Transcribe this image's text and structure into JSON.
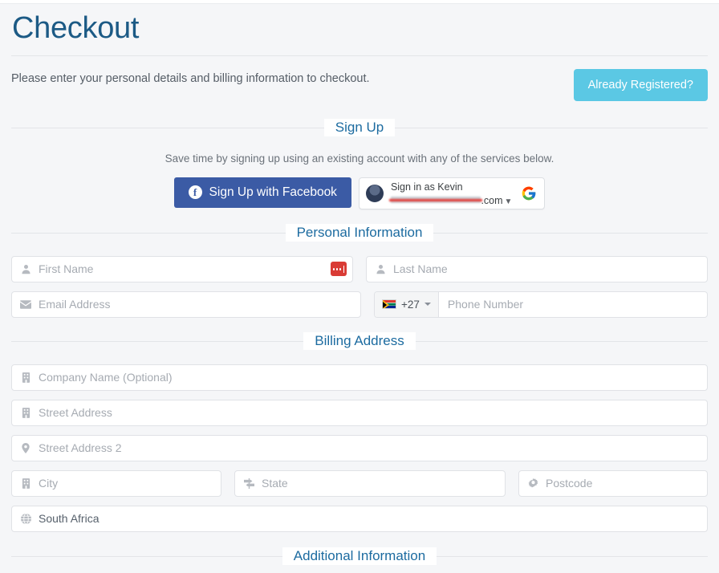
{
  "page": {
    "title": "Checkout",
    "intro": "Please enter your personal details and billing information to checkout.",
    "already_registered_label": "Already Registered?",
    "accent_blue": "#1c6ba0",
    "button_blue": "#5bc8e4"
  },
  "signup": {
    "legend": "Sign Up",
    "note": "Save time by signing up using an existing account with any of the services below.",
    "facebook_label": "Sign Up with Facebook",
    "facebook_color": "#3b5ba5",
    "google": {
      "name_line": "Sign in as Kevin",
      "email_suffix": ".com",
      "email_redacted": true,
      "chevron": "⌄"
    }
  },
  "personal_information": {
    "legend": "Personal Information",
    "fields": [
      {
        "name": "first-name",
        "placeholder": "First Name",
        "icon": "user-icon",
        "value": ""
      },
      {
        "name": "last-name",
        "placeholder": "Last Name",
        "icon": "user-icon",
        "value": ""
      },
      {
        "name": "email-address",
        "placeholder": "Email Address",
        "icon": "envelope-icon",
        "value": ""
      }
    ],
    "phone": {
      "country_code": "+27",
      "country_flag": "south-africa-flag",
      "placeholder": "Phone Number",
      "value": ""
    }
  },
  "billing_address": {
    "legend": "Billing Address",
    "fields": [
      {
        "name": "company-name",
        "placeholder": "Company Name (Optional)",
        "icon": "building-icon",
        "value": ""
      },
      {
        "name": "street-address",
        "placeholder": "Street Address",
        "icon": "building-icon",
        "value": ""
      },
      {
        "name": "street-address-2",
        "placeholder": "Street Address 2",
        "icon": "map-pin-icon",
        "value": ""
      },
      {
        "name": "city",
        "placeholder": "City",
        "icon": "building-icon",
        "value": ""
      },
      {
        "name": "state",
        "placeholder": "State",
        "icon": "map-signs-icon",
        "value": ""
      },
      {
        "name": "postcode",
        "placeholder": "Postcode",
        "icon": "gear-icon",
        "value": ""
      }
    ],
    "country": {
      "name": "country",
      "icon": "globe-icon",
      "value": "South Africa"
    }
  },
  "additional_information": {
    "legend": "Additional Information"
  }
}
